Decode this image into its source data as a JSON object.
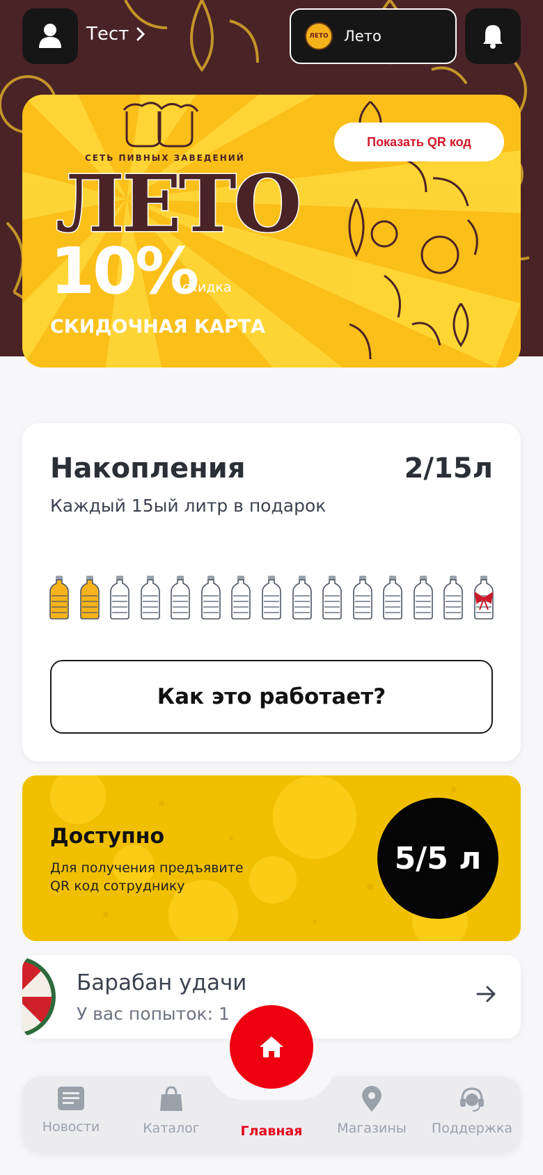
{
  "header": {
    "user_name": "Тест",
    "store_name": "Лето",
    "store_logo_text": "ЛЕТО"
  },
  "card": {
    "brand_subtitle": "СЕТЬ ПИВНЫХ ЗАВЕДЕНИЙ",
    "brand_name": "ЛЕТО",
    "discount_value": "10%",
    "discount_label": "скидка",
    "card_type": "СКИДОЧНАЯ КАРТА",
    "qr_button": "Показать QR код"
  },
  "savings": {
    "title": "Накопления",
    "count": "2/15л",
    "subtitle": "Каждый 15ый литр в подарок",
    "filled": 2,
    "total": 15,
    "how_button": "Как это работает?"
  },
  "available": {
    "title": "Доступно",
    "text": "Для получения предъявите QR код сотруднику",
    "value": "5/5 л"
  },
  "wheel": {
    "title": "Барабан удачи",
    "subtitle": "У вас попыток: 1"
  },
  "nav": {
    "items": [
      {
        "label": "Новости",
        "icon": "news-icon"
      },
      {
        "label": "Каталог",
        "icon": "bag-icon"
      },
      {
        "label": "Главная",
        "icon": "home-icon",
        "active": true
      },
      {
        "label": "Магазины",
        "icon": "location-icon"
      },
      {
        "label": "Поддержка",
        "icon": "support-icon"
      }
    ]
  },
  "colors": {
    "accent_red": "#ee0011",
    "brand_yellow": "#fbbf1a",
    "brand_brown": "#4a2326"
  }
}
